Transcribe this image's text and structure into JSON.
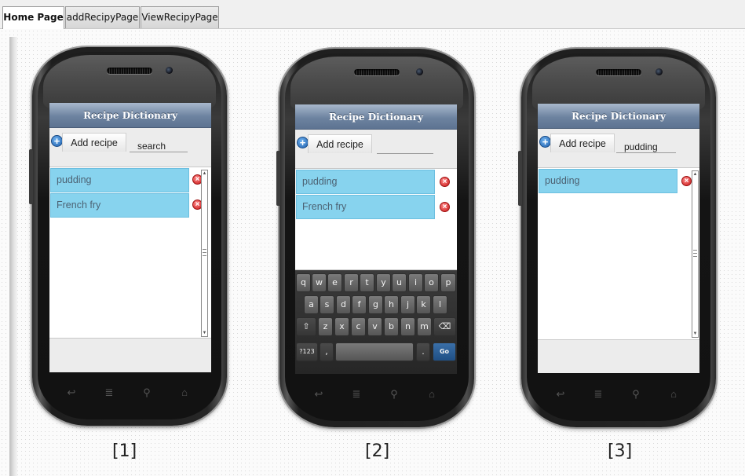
{
  "tabs": [
    {
      "label": "Home Page"
    },
    {
      "label": "addRecipyPage"
    },
    {
      "label": "ViewRecipyPage"
    }
  ],
  "app": {
    "title": "Recipe Dictionary",
    "add_label": "Add recipe"
  },
  "phones": [
    {
      "caption": "[1]",
      "search_value": "search",
      "items": [
        "pudding",
        "French fry"
      ]
    },
    {
      "caption": "[2]",
      "search_value": "",
      "items": [
        "pudding",
        "French fry"
      ]
    },
    {
      "caption": "[3]",
      "search_value": "pudding",
      "items": [
        "pudding"
      ]
    }
  ],
  "keyboard": {
    "row1": [
      "q",
      "w",
      "e",
      "r",
      "t",
      "y",
      "u",
      "i",
      "o",
      "p"
    ],
    "row2": [
      "a",
      "s",
      "d",
      "f",
      "g",
      "h",
      "j",
      "k",
      "l"
    ],
    "row3": [
      "⇧",
      "z",
      "x",
      "c",
      "v",
      "b",
      "n",
      "m",
      "⌫"
    ],
    "row4": [
      "?123",
      ",",
      "",
      ".",
      "Go"
    ]
  },
  "icons": {
    "add": "plus-circle-icon",
    "delete": "delete-circle-icon",
    "nav": [
      "back-icon",
      "menu-icon",
      "search-icon",
      "home-icon"
    ]
  },
  "colors": {
    "title_bar": "#6d83a0",
    "list_item": "#87d3ee",
    "add_icon": "#1f5fad",
    "delete_icon": "#c81616"
  }
}
